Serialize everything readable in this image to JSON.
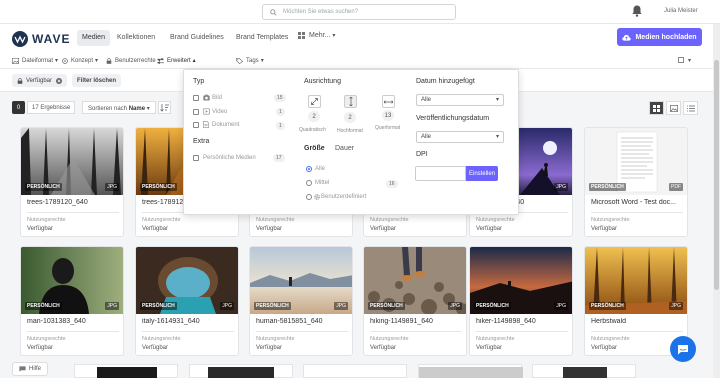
{
  "search": {
    "placeholder": "Möchten Sie etwas suchen?"
  },
  "user": {
    "name": "Julia Meister"
  },
  "logo": {
    "text": "WAVE"
  },
  "nav": {
    "items": [
      "Medien",
      "Kollektionen",
      "Brand Guidelines",
      "Brand Templates",
      "Mehr..."
    ],
    "upload_label": "Medien hochladen"
  },
  "filters": {
    "items": [
      "Dateiformat",
      "Konzept",
      "Benutzerrechte",
      "Erweitert",
      "Tags"
    ]
  },
  "chips": {
    "active": "Verfügbar",
    "clear": "Filter löschen"
  },
  "toolbar": {
    "count": "0",
    "results": "17 Ergebnisse",
    "sort_prefix": "Sortieren nach",
    "sort_value": "Name"
  },
  "dropdown": {
    "type_heading": "Typ",
    "types": [
      {
        "label": "Bild",
        "count": "15"
      },
      {
        "label": "Video",
        "count": "1"
      },
      {
        "label": "Dokument",
        "count": "1"
      }
    ],
    "extra_heading": "Extra",
    "extra": {
      "label": "Persönliche Medien",
      "count": "17"
    },
    "orientation_heading": "Ausrichtung",
    "orientations": [
      {
        "label": "Quadratisch",
        "count": "2"
      },
      {
        "label": "Hochformat",
        "count": "2"
      },
      {
        "label": "Querformat",
        "count": "13"
      }
    ],
    "tabs": [
      "Größe",
      "Dauer"
    ],
    "sizes": [
      {
        "label": "Alle"
      },
      {
        "label": "Mittel",
        "count": "16"
      },
      {
        "label": "Benutzerdefiniert"
      }
    ],
    "date_added_heading": "Datum hinzugefügt",
    "date_added_value": "Alle",
    "published_heading": "Veröffentlichungsdatum",
    "published_value": "Alle",
    "dpi_heading": "DPI",
    "dpi_button": "Einstellen"
  },
  "cards_row1": [
    {
      "name": "trees-1789120_640",
      "badge": "PERSÖNLICH",
      "type": "JPG",
      "rights_label": "Nutzungsrechte",
      "rights_value": "Verfügbar"
    },
    {
      "name": "trees-1789120_640",
      "badge": "PERSÖNLICH",
      "type": "JPG",
      "rights_label": "Nutzungsrechte",
      "rights_value": "Verfügbar"
    },
    {
      "name": "",
      "badge": "",
      "type": "",
      "rights_label": "Nutzungsrechte",
      "rights_value": "Verfügbar"
    },
    {
      "name": "",
      "badge": "",
      "type": "",
      "rights_label": "Nutzungsrechte",
      "rights_value": "Verfügbar"
    },
    {
      "name": "...1185474_640",
      "badge": "",
      "type": "JPG",
      "rights_label": "Nutzungsrechte",
      "rights_value": "Verfügbar"
    },
    {
      "name": "Microsoft Word - Test doc...",
      "badge": "PERSÖNLICH",
      "type": "PDF",
      "rights_label": "Nutzungsrechte",
      "rights_value": "Verfügbar"
    }
  ],
  "cards_row2": [
    {
      "name": "man-1031383_640",
      "badge": "PERSÖNLICH",
      "type": "JPG",
      "rights_label": "Nutzungsrechte",
      "rights_value": "Verfügbar"
    },
    {
      "name": "italy-1614931_640",
      "badge": "PERSÖNLICH",
      "type": "JPG",
      "rights_label": "Nutzungsrechte",
      "rights_value": "Verfügbar"
    },
    {
      "name": "human-5815851_640",
      "badge": "PERSÖNLICH",
      "type": "JPG",
      "rights_label": "Nutzungsrechte",
      "rights_value": "Verfügbar"
    },
    {
      "name": "hiking-1149891_640",
      "badge": "PERSÖNLICH",
      "type": "JPG",
      "rights_label": "Nutzungsrechte",
      "rights_value": "Verfügbar"
    },
    {
      "name": "hiker-1149898_640",
      "badge": "PERSÖNLICH",
      "type": "JPG",
      "rights_label": "Nutzungsrechte",
      "rights_value": "Verfügbar"
    },
    {
      "name": "Herbstwald",
      "badge": "PERSÖNLICH",
      "type": "JPG",
      "rights_label": "Nutzungsrechte",
      "rights_value": "Verfügbar"
    }
  ],
  "help": {
    "label": "Hilfe"
  },
  "colors": {
    "accent": "#6c63ff",
    "brand": "#1f3350",
    "chat": "#1a73e8"
  }
}
